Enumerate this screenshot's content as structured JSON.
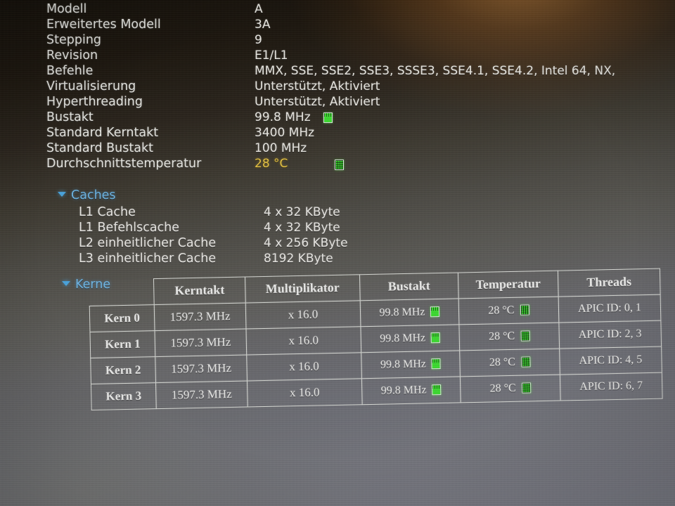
{
  "properties": [
    {
      "label": "Modell",
      "value": "A"
    },
    {
      "label": "Erweitertes Modell",
      "value": "3A"
    },
    {
      "label": "Stepping",
      "value": "9"
    },
    {
      "label": "Revision",
      "value": "E1/L1"
    },
    {
      "label": "Befehle",
      "value": "MMX, SSE, SSE2, SSE3, SSSE3, SSE4.1, SSE4.2, Intel 64, NX,"
    },
    {
      "label": "Virtualisierung",
      "value": "Unterstützt, Aktiviert"
    },
    {
      "label": "Hyperthreading",
      "value": "Unterstützt, Aktiviert"
    },
    {
      "label": "Bustakt",
      "value": "99.8 MHz",
      "icon": "bars-indicator-icon"
    },
    {
      "label": "Standard Kerntakt",
      "value": "3400 MHz"
    },
    {
      "label": "Standard Bustakt",
      "value": "100 MHz"
    },
    {
      "label": "Durchschnittstemperatur",
      "value": "28 °C",
      "gold": true,
      "icon": "mesh-indicator-icon"
    }
  ],
  "caches": {
    "title": "Caches",
    "rows": [
      {
        "label": "L1 Cache",
        "value": "4 x 32 KByte"
      },
      {
        "label": "L1 Befehlscache",
        "value": "4 x 32 KByte"
      },
      {
        "label": "L2 einheitlicher Cache",
        "value": "4 x 256 KByte"
      },
      {
        "label": "L3 einheitlicher Cache",
        "value": "8192 KByte"
      }
    ]
  },
  "cores": {
    "title": "Kerne",
    "headers": [
      "",
      "Kerntakt",
      "Multiplikator",
      "Bustakt",
      "Temperatur",
      "Threads"
    ],
    "rows": [
      {
        "name": "Kern 0",
        "clock": "1597.3 MHz",
        "multiplier": "x 16.0",
        "bus": "99.8 MHz",
        "temperature": "28 °C",
        "threads": "APIC ID: 0, 1"
      },
      {
        "name": "Kern 1",
        "clock": "1597.3 MHz",
        "multiplier": "x 16.0",
        "bus": "99.8 MHz",
        "temperature": "28 °C",
        "threads": "APIC ID: 2, 3"
      },
      {
        "name": "Kern 2",
        "clock": "1597.3 MHz",
        "multiplier": "x 16.0",
        "bus": "99.8 MHz",
        "temperature": "28 °C",
        "threads": "APIC ID: 4, 5"
      },
      {
        "name": "Kern 3",
        "clock": "1597.3 MHz",
        "multiplier": "x 16.0",
        "bus": "99.8 MHz",
        "temperature": "28 °C",
        "threads": "APIC ID: 6, 7"
      }
    ]
  },
  "colors": {
    "text": "#ececea",
    "gold": "#e8c542",
    "section_blue": "#6fb8e8",
    "indicator_green": "#3ddd31"
  }
}
